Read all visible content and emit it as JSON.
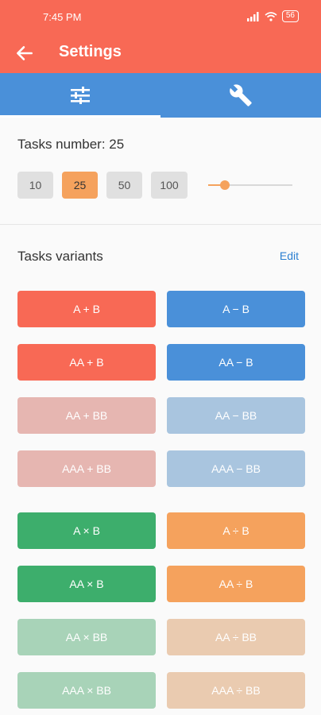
{
  "status_bar": {
    "time": "7:45 PM",
    "battery": "56"
  },
  "toolbar": {
    "title": "Settings"
  },
  "tabs": [
    {
      "icon": "sliders-icon",
      "active": true
    },
    {
      "icon": "wrench-icon",
      "active": false
    }
  ],
  "tasks_number": {
    "label": "Tasks number: 25",
    "options": [
      "10",
      "25",
      "50",
      "100"
    ],
    "selected": "25",
    "slider_fraction": 0.2
  },
  "variants": {
    "title": "Tasks variants",
    "edit_label": "Edit",
    "items": [
      {
        "label": "A + B",
        "color": "#f86955"
      },
      {
        "label": "A − B",
        "color": "#4a90d9"
      },
      {
        "label": "AA + B",
        "color": "#f86955"
      },
      {
        "label": "AA − B",
        "color": "#4a90d9"
      },
      {
        "label": "AA + BB",
        "color": "#e6b6b1"
      },
      {
        "label": "AA − BB",
        "color": "#a9c5df"
      },
      {
        "label": "AAA + BB",
        "color": "#e6b6b1"
      },
      {
        "label": "AAA − BB",
        "color": "#a9c5df"
      },
      {
        "label": "A × B",
        "color": "#3dae6c"
      },
      {
        "label": "A ÷ B",
        "color": "#f5a25d"
      },
      {
        "label": "AA × B",
        "color": "#3dae6c"
      },
      {
        "label": "AA ÷ B",
        "color": "#f5a25d"
      },
      {
        "label": "AA × BB",
        "color": "#a8d3b8"
      },
      {
        "label": "AA ÷ BB",
        "color": "#eacbb0"
      },
      {
        "label": "AAA × BB",
        "color": "#a8d3b8"
      },
      {
        "label": "AAA ÷ BB",
        "color": "#eacbb0"
      }
    ]
  }
}
